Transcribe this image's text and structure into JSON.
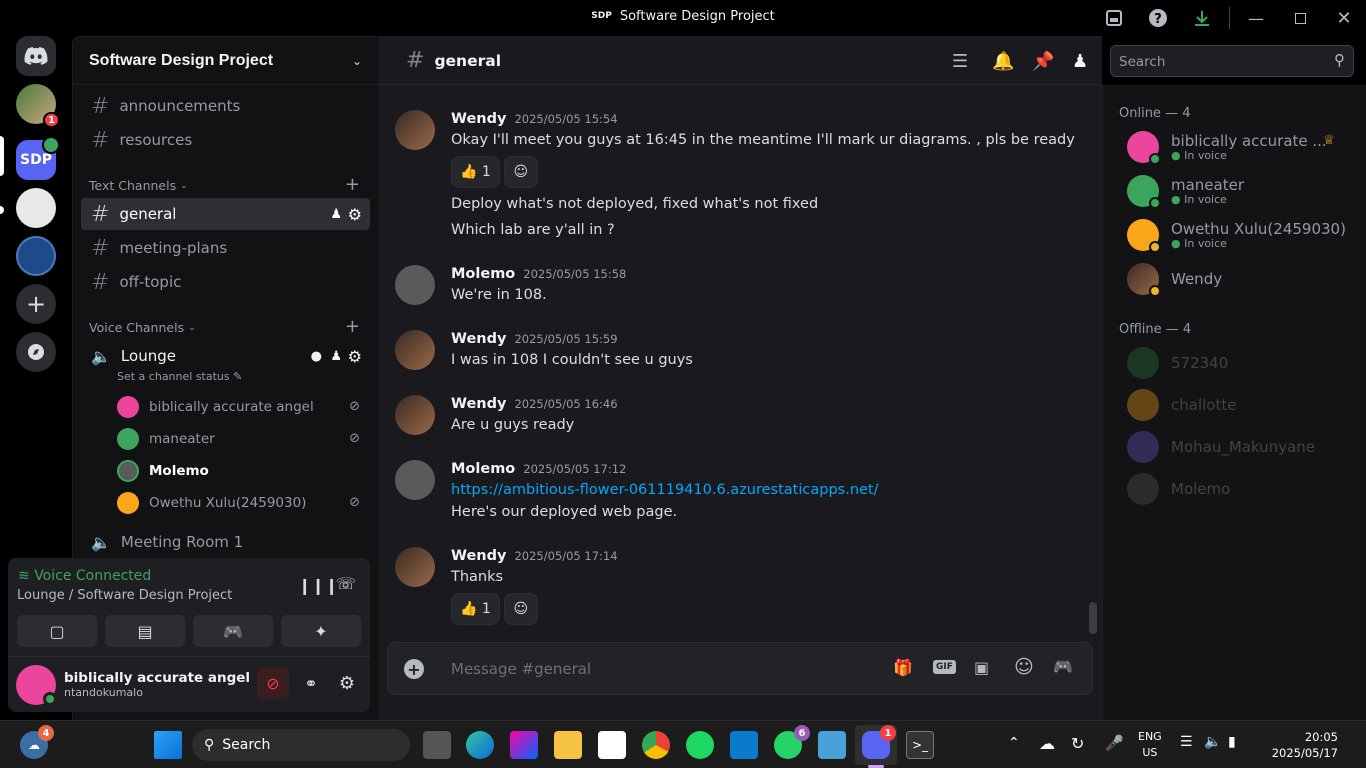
{
  "window": {
    "title_badge": "SDP",
    "title": "Software Design Project"
  },
  "sidebar": {
    "server_name": "Software Design Project",
    "top_channels": [
      {
        "name": "announcements"
      },
      {
        "name": "resources"
      }
    ],
    "text_category": "Text Channels",
    "text_channels": [
      {
        "name": "general"
      },
      {
        "name": "meeting-plans"
      },
      {
        "name": "off-topic"
      }
    ],
    "voice_category": "Voice Channels",
    "voice_channel": {
      "name": "Lounge",
      "status_placeholder": "Set a channel status"
    },
    "voice_users": [
      {
        "name": "biblically accurate angel",
        "color": "#eb459e"
      },
      {
        "name": "maneater",
        "color": "#3ba55c"
      },
      {
        "name": "Molemo",
        "color": "#5a5a5a"
      },
      {
        "name": "Owethu Xulu(2459030)",
        "color": "#faa61a"
      }
    ],
    "voice_channel_2": "Meeting Room 1"
  },
  "voice_panel": {
    "title": "Voice Connected",
    "subtitle": "Lounge / Software Design Project"
  },
  "user_panel": {
    "display_name": "biblically accurate angel",
    "username": "ntandokumalo"
  },
  "channel": {
    "name": "general",
    "search_placeholder": "Search",
    "composer_placeholder": "Message #general"
  },
  "messages": [
    {
      "author": "Wendy",
      "time": "2025/05/05 15:54",
      "lines": [
        "Okay I'll meet you guys at 16:45 in the meantime I'll mark ur diagrams. , pls be ready"
      ],
      "reaction_count": "1"
    },
    {
      "lines": [
        "Deploy what's not deployed, fixed what's not fixed",
        "Which lab are y'all in ?"
      ]
    },
    {
      "author": "Molemo",
      "time": "2025/05/05 15:58",
      "lines": [
        "We're in 108."
      ]
    },
    {
      "author": "Wendy",
      "time": "2025/05/05 15:59",
      "lines": [
        "I was in 108 I couldn't see u guys"
      ]
    },
    {
      "author": "Wendy",
      "time": "2025/05/05 16:46",
      "lines": [
        "Are u guys ready"
      ]
    },
    {
      "author": "Molemo",
      "time": "2025/05/05 17:12",
      "link": "https://ambitious-flower-061119410.6.azurestaticapps.net/",
      "lines": [
        "Here's our deployed web page."
      ]
    },
    {
      "author": "Wendy",
      "time": "2025/05/05 17:14",
      "lines": [
        "Thanks"
      ],
      "reaction_count": "1"
    }
  ],
  "members": {
    "online_header": "Online — 4",
    "online": [
      {
        "name": "biblically accurate ...",
        "sub": "In voice",
        "color": "#eb459e"
      },
      {
        "name": "maneater",
        "sub": "In voice",
        "color": "#3ba55c"
      },
      {
        "name": "Owethu Xulu(2459030)",
        "sub": "In voice",
        "color": "#faa61a"
      },
      {
        "name": "Wendy",
        "sub": "",
        "color": "#6b4a3a"
      }
    ],
    "offline_header": "Offline — 4",
    "offline": [
      {
        "name": "572340",
        "color": "#2f7a3a"
      },
      {
        "name": "challotte",
        "color": "#faa61a"
      },
      {
        "name": "Mohau_Makunyane",
        "color": "#6a5acd"
      },
      {
        "name": "Molemo",
        "color": "#5a5a5a"
      }
    ]
  },
  "taskbar": {
    "weather_badge": "4",
    "search_label": "Search",
    "whatsapp_badge": "6",
    "discord_badge": "1",
    "lang_line1": "ENG",
    "lang_line2": "US",
    "time": "20:05",
    "date": "2025/05/17"
  },
  "guild_badge": "1"
}
